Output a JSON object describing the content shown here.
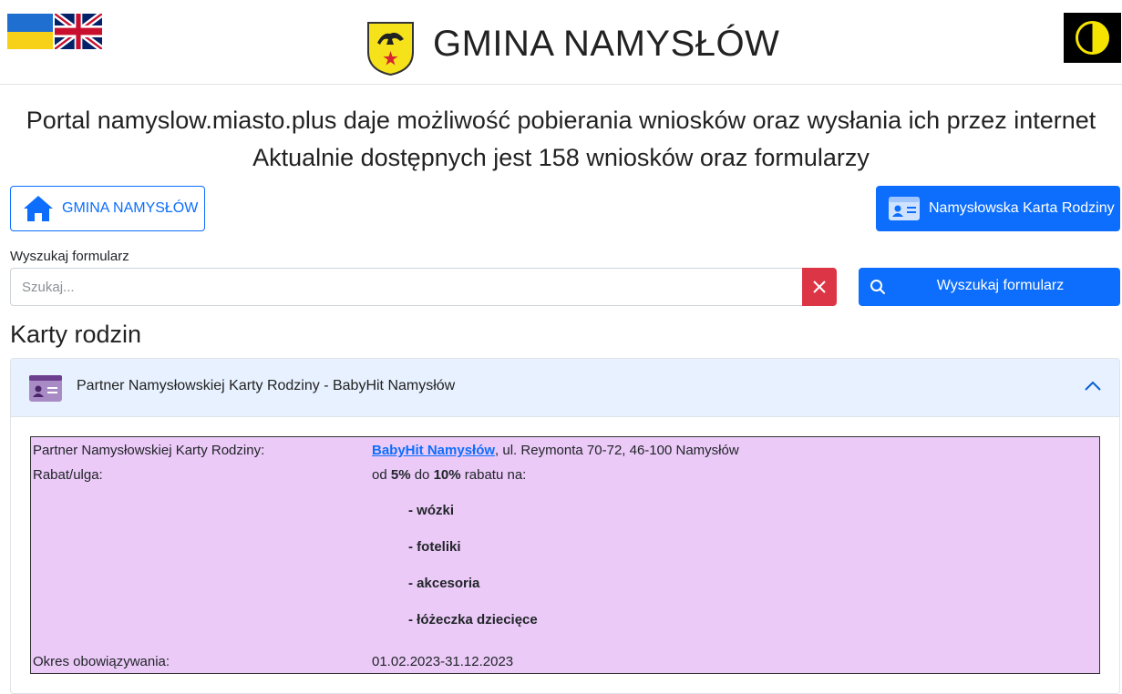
{
  "header": {
    "title": "GMINA NAMYSŁÓW",
    "icons": [
      "flag-ukraine-icon",
      "flag-uk-icon",
      "crest-icon",
      "contrast-icon"
    ]
  },
  "intro": {
    "line1": "Portal namyslow.miasto.plus daje możliwość pobierania wniosków oraz wysłania ich przez internet",
    "line2": "Aktualnie dostępnych jest 158 wniosków oraz formularzy"
  },
  "buttons": {
    "home_label": "GMINA NAMYSŁÓW",
    "card_label": "Namysłowska Karta Rodziny"
  },
  "search": {
    "label": "Wyszukaj formularz",
    "placeholder": "Szukaj...",
    "button_label": "Wyszukaj formularz"
  },
  "section": {
    "title": "Karty rodzin"
  },
  "accordion": {
    "title": "Partner Namysłowskiej Karty Rodziny - BabyHit Namysłów",
    "expanded": true,
    "details": {
      "partner_key": "Partner Namysłowskiej Karty Rodziny:",
      "partner_link": "BabyHit Namysłów",
      "partner_address": ", ul. Reymonta 70-72, 46-100 Namysłów",
      "discount_key": "Rabat/ulga:",
      "discount_prefix": "od ",
      "discount_min": "5%",
      "discount_mid": " do ",
      "discount_max": "10%",
      "discount_suffix": " rabatu na:",
      "items": [
        "- wózki",
        "- foteliki",
        "- akcesoria",
        "- łóżeczka dziecięce"
      ],
      "validity_key": "Okres obowiązywania:",
      "validity_value": "01.02.2023-31.12.2023"
    }
  },
  "colors": {
    "primary": "#0d6efd",
    "danger": "#dc3545",
    "accordion_header": "#e7f1ff",
    "info_box": "#ebcaf7"
  }
}
